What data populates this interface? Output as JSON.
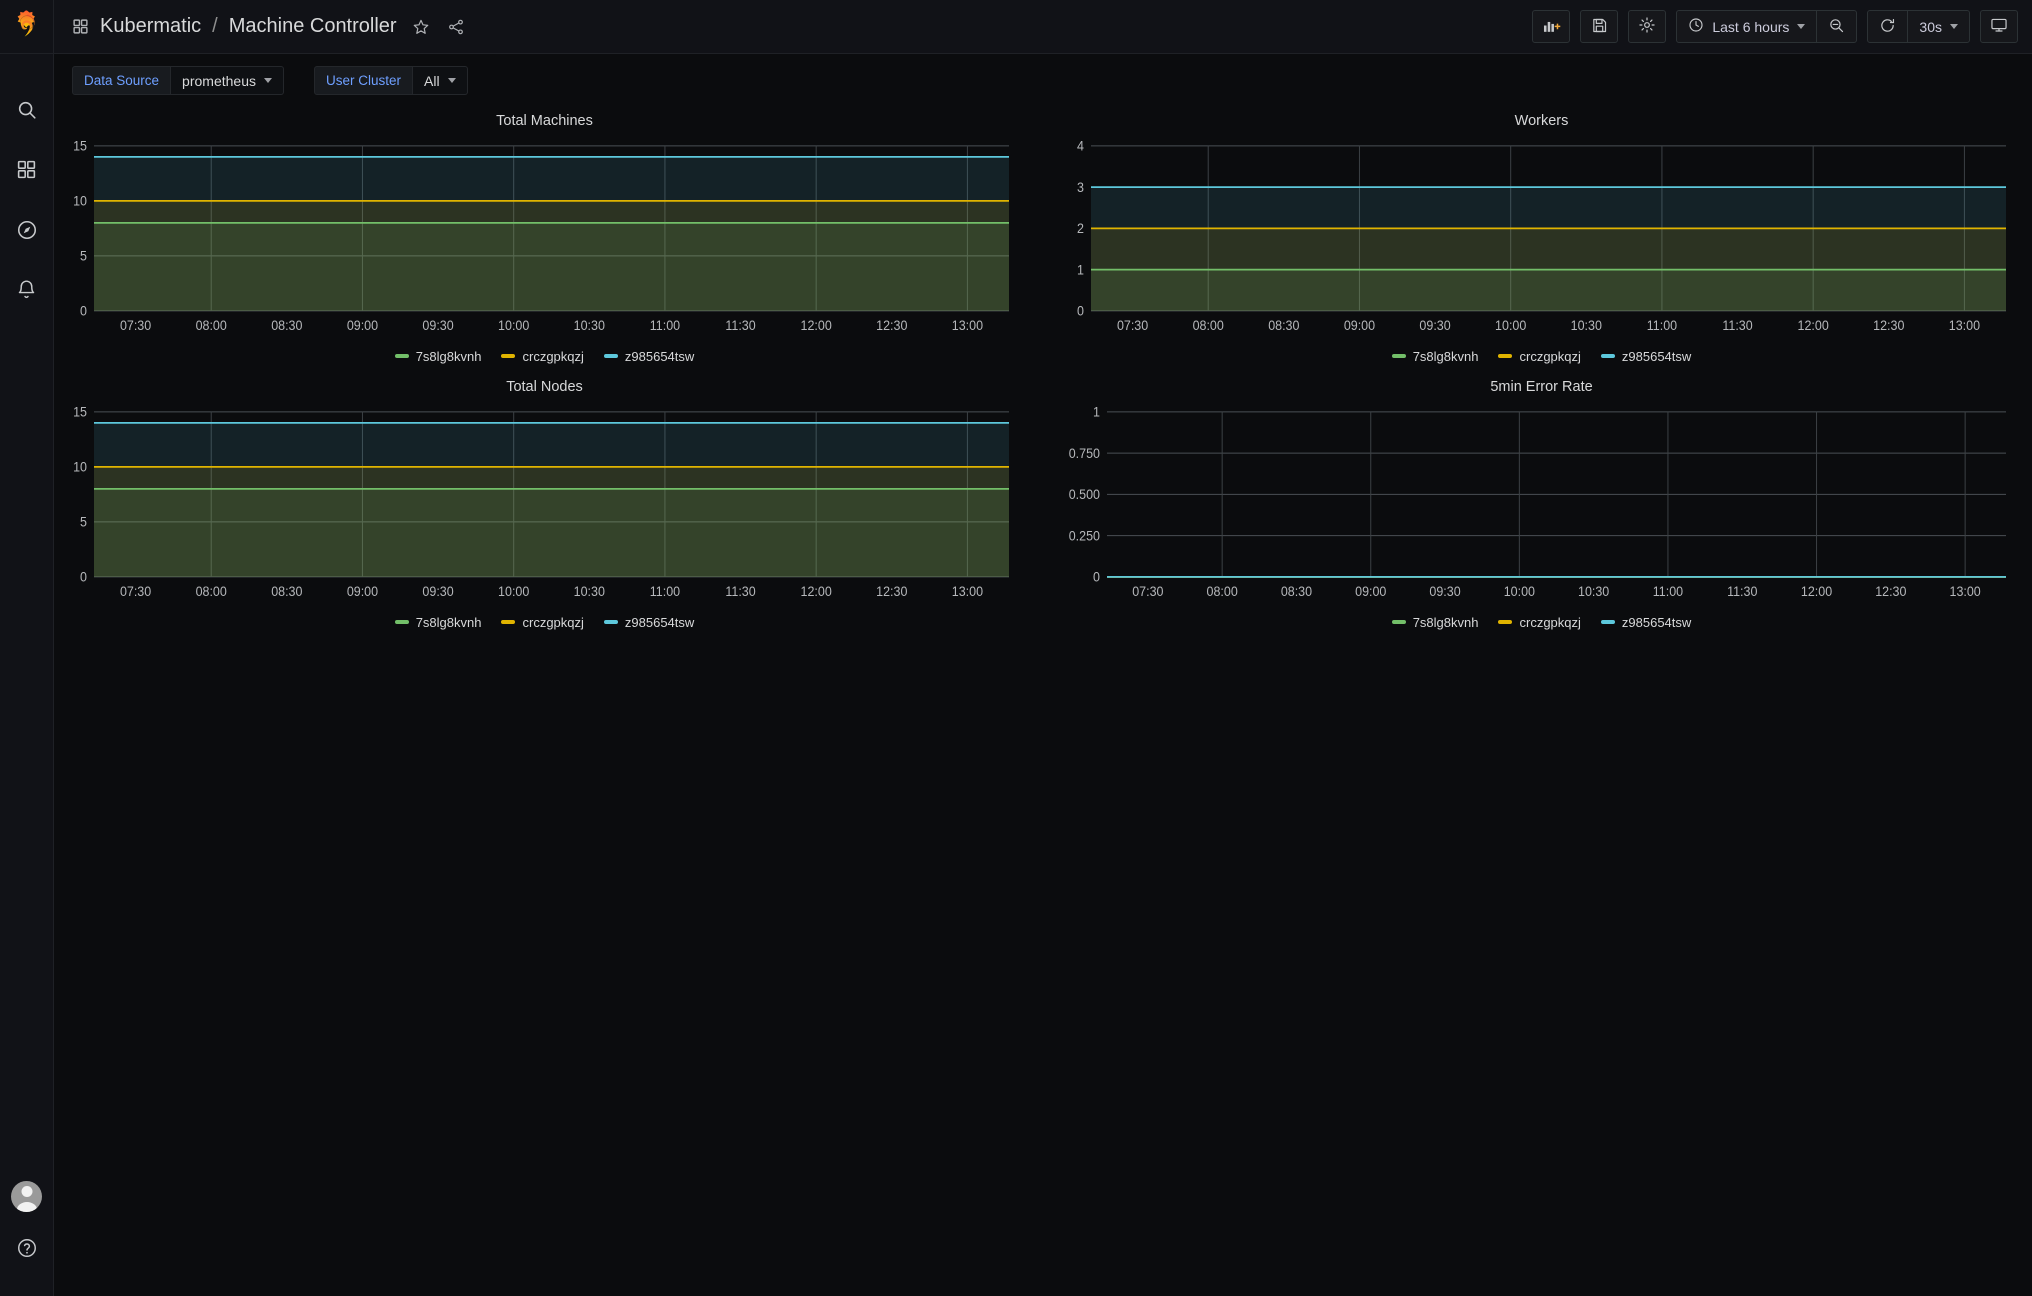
{
  "brand": {
    "logo": "grafana-logo"
  },
  "sidebar": {
    "items": [
      {
        "name": "search-icon",
        "label": "Search"
      },
      {
        "name": "dashboards-icon",
        "label": "Dashboards"
      },
      {
        "name": "explore-icon",
        "label": "Explore"
      },
      {
        "name": "alerting-icon",
        "label": "Alerting"
      }
    ],
    "bottom": [
      {
        "name": "avatar",
        "label": "User"
      },
      {
        "name": "help-icon",
        "label": "?"
      }
    ]
  },
  "header": {
    "dashboard_icon": "dashboard-grid-icon",
    "folder": "Kubermatic",
    "separator": "/",
    "title": "Machine Controller",
    "star_icon": "star-icon",
    "share_icon": "share-icon"
  },
  "toolbar": {
    "add_panel": "add-panel-icon",
    "save": "save-icon",
    "settings": "settings-gear-icon",
    "time_range": "Last 6 hours",
    "time_icon": "clock-icon",
    "zoom_out": "zoom-out-icon",
    "refresh": "refresh-icon",
    "refresh_interval": "30s",
    "kiosk": "tv-icon"
  },
  "variables": [
    {
      "label": "Data Source",
      "value": "prometheus",
      "name": "datasource"
    },
    {
      "label": "User Cluster",
      "value": "All",
      "name": "user-cluster"
    }
  ],
  "series_colors": {
    "green": "#73BF69",
    "yellow": "#E0B400",
    "cyan": "#5DC8DC"
  },
  "legend": [
    {
      "label": "7s8lg8kvnh",
      "color": "#73BF69"
    },
    {
      "label": "crczgpkqzj",
      "color": "#E0B400"
    },
    {
      "label": "z985654tsw",
      "color": "#5DC8DC"
    }
  ],
  "time_ticks": [
    "07:30",
    "08:00",
    "08:30",
    "09:00",
    "09:30",
    "10:00",
    "10:30",
    "11:00",
    "11:30",
    "12:00",
    "12:30",
    "13:00"
  ],
  "chart_data": [
    {
      "type": "line",
      "title": "Total Machines",
      "xlabel": "",
      "ylabel": "",
      "ylim": [
        0,
        15
      ],
      "yticks": [
        "0",
        "5",
        "10",
        "15"
      ],
      "ytick_values": [
        0,
        5,
        10,
        15
      ],
      "x": [
        "07:30",
        "08:00",
        "08:30",
        "09:00",
        "09:30",
        "10:00",
        "10:30",
        "11:00",
        "11:30",
        "12:00",
        "12:30",
        "13:00"
      ],
      "grid": true,
      "legend_position": "bottom",
      "fill": true,
      "series": [
        {
          "name": "7s8lg8kvnh",
          "color": "#73BF69",
          "values": [
            8,
            8,
            8,
            8,
            8,
            8,
            8,
            8,
            8,
            8,
            8,
            8
          ]
        },
        {
          "name": "crczgpkqzj",
          "color": "#E0B400",
          "values": [
            10,
            10,
            10,
            10,
            10,
            10,
            10,
            10,
            10,
            10,
            10,
            10
          ]
        },
        {
          "name": "z985654tsw",
          "color": "#5DC8DC",
          "values": [
            14,
            14,
            14,
            14,
            14,
            14,
            14,
            14,
            14,
            14,
            14,
            14
          ]
        }
      ]
    },
    {
      "type": "line",
      "title": "Workers",
      "xlabel": "",
      "ylabel": "",
      "ylim": [
        0,
        4
      ],
      "yticks": [
        "0",
        "1",
        "2",
        "3",
        "4"
      ],
      "ytick_values": [
        0,
        1,
        2,
        3,
        4
      ],
      "x": [
        "07:30",
        "08:00",
        "08:30",
        "09:00",
        "09:30",
        "10:00",
        "10:30",
        "11:00",
        "11:30",
        "12:00",
        "12:30",
        "13:00"
      ],
      "grid": true,
      "legend_position": "bottom",
      "fill": true,
      "series": [
        {
          "name": "7s8lg8kvnh",
          "color": "#73BF69",
          "values": [
            1,
            1,
            1,
            1,
            1,
            1,
            1,
            1,
            1,
            1,
            1,
            1
          ]
        },
        {
          "name": "crczgpkqzj",
          "color": "#E0B400",
          "values": [
            2,
            2,
            2,
            2,
            2,
            2,
            2,
            2,
            2,
            2,
            2,
            2
          ]
        },
        {
          "name": "z985654tsw",
          "color": "#5DC8DC",
          "values": [
            3,
            3,
            3,
            3,
            3,
            3,
            3,
            3,
            3,
            3,
            3,
            3
          ]
        }
      ]
    },
    {
      "type": "line",
      "title": "Total Nodes",
      "xlabel": "",
      "ylabel": "",
      "ylim": [
        0,
        15
      ],
      "yticks": [
        "0",
        "5",
        "10",
        "15"
      ],
      "ytick_values": [
        0,
        5,
        10,
        15
      ],
      "x": [
        "07:30",
        "08:00",
        "08:30",
        "09:00",
        "09:30",
        "10:00",
        "10:30",
        "11:00",
        "11:30",
        "12:00",
        "12:30",
        "13:00"
      ],
      "grid": true,
      "legend_position": "bottom",
      "fill": true,
      "series": [
        {
          "name": "7s8lg8kvnh",
          "color": "#73BF69",
          "values": [
            8,
            8,
            8,
            8,
            8,
            8,
            8,
            8,
            8,
            8,
            8,
            8
          ]
        },
        {
          "name": "crczgpkqzj",
          "color": "#E0B400",
          "values": [
            10,
            10,
            10,
            10,
            10,
            10,
            10,
            10,
            10,
            10,
            10,
            10
          ]
        },
        {
          "name": "z985654tsw",
          "color": "#5DC8DC",
          "values": [
            14,
            14,
            14,
            14,
            14,
            14,
            14,
            14,
            14,
            14,
            14,
            14
          ]
        }
      ]
    },
    {
      "type": "line",
      "title": "5min Error Rate",
      "xlabel": "",
      "ylabel": "",
      "ylim": [
        0,
        1
      ],
      "yticks": [
        "0",
        "0.250",
        "0.500",
        "0.750",
        "1"
      ],
      "ytick_values": [
        0,
        0.25,
        0.5,
        0.75,
        1
      ],
      "x": [
        "07:30",
        "08:00",
        "08:30",
        "09:00",
        "09:30",
        "10:00",
        "10:30",
        "11:00",
        "11:30",
        "12:00",
        "12:30",
        "13:00"
      ],
      "grid": true,
      "legend_position": "bottom",
      "fill": false,
      "series": [
        {
          "name": "7s8lg8kvnh",
          "color": "#73BF69",
          "values": [
            0,
            0,
            0,
            0,
            0,
            0,
            0,
            0,
            0,
            0,
            0,
            0
          ]
        },
        {
          "name": "crczgpkqzj",
          "color": "#E0B400",
          "values": [
            0,
            0,
            0,
            0,
            0,
            0,
            0,
            0,
            0,
            0,
            0,
            0
          ]
        },
        {
          "name": "z985654tsw",
          "color": "#5DC8DC",
          "values": [
            0,
            0,
            0,
            0,
            0,
            0,
            0,
            0,
            0,
            0,
            0,
            0
          ]
        }
      ]
    }
  ]
}
